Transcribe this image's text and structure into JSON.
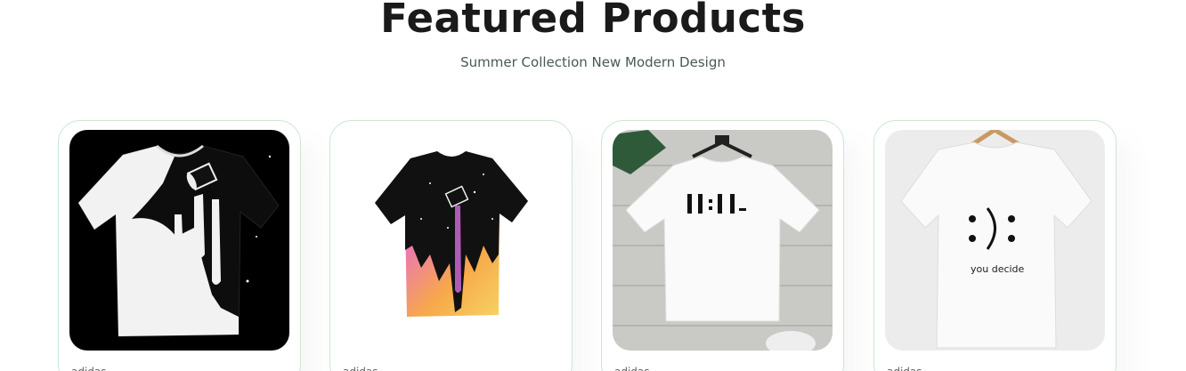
{
  "section": {
    "title": "Featured Products",
    "subtitle": "Summer Collection New Modern Design"
  },
  "products": [
    {
      "brand": "adidas",
      "image": "black-white-spill-tshirt"
    },
    {
      "brand": "adidas",
      "image": "galaxy-rainbow-spill-tshirt"
    },
    {
      "brand": "adidas",
      "image": "white-11-11-pm-tshirt"
    },
    {
      "brand": "adidas",
      "image": "white-smiley-you-decide-tshirt",
      "print_text": "you decide"
    }
  ],
  "colors": {
    "card_border": "#cce7d0",
    "subtitle": "#465b52",
    "title": "#1a1a1a"
  }
}
